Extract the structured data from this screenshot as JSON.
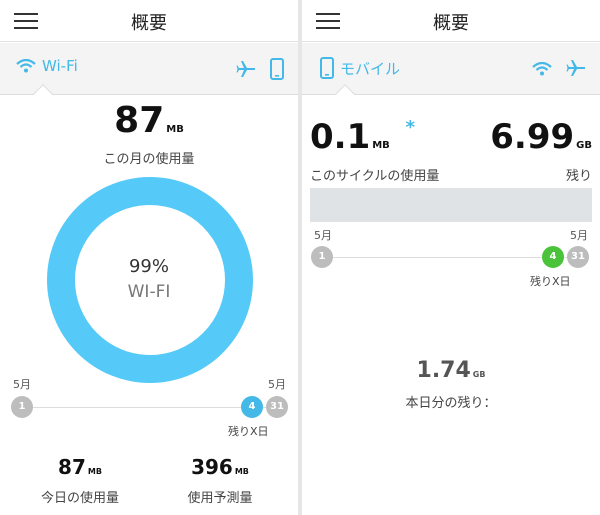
{
  "left": {
    "title": "概要",
    "selector": {
      "label": "Wi-Fi",
      "icon": "wifi-icon"
    },
    "icons": [
      "airplane-icon",
      "phone-icon"
    ],
    "usage": {
      "value": "87",
      "unit": "MB",
      "label": "この月の使用量"
    },
    "donut": {
      "percent": "99%",
      "label": "WI-FI",
      "fill": 0.99,
      "color": "#55caf8"
    },
    "timeline": {
      "start_month": "5月",
      "end_month": "5月",
      "start_day": "1",
      "today": "4",
      "end_day": "31",
      "remaining_label": "残りX日"
    },
    "stats": [
      {
        "value": "87",
        "unit": "MB",
        "label": "今日の使用量"
      },
      {
        "value": "396",
        "unit": "MB",
        "label": "使用予測量"
      }
    ]
  },
  "right": {
    "title": "概要",
    "selector": {
      "label": "モバイル",
      "icon": "phone-icon"
    },
    "icons": [
      "wifi-icon",
      "airplane-icon"
    ],
    "used": {
      "value": "0.1",
      "unit": "MB",
      "mark": "*",
      "label": "このサイクルの使用量"
    },
    "remaining": {
      "value": "6.99",
      "unit": "GB",
      "label": "残り"
    },
    "usage_bar_fill": 0.0,
    "timeline": {
      "start_month": "5月",
      "end_month": "5月",
      "start_day": "1",
      "today": "4",
      "end_day": "31",
      "remaining_label": "残りX日"
    },
    "daily": {
      "value": "1.74",
      "unit": "GB",
      "label": "本日分の残り："
    }
  },
  "colors": {
    "accent": "#44b9e8",
    "ring": "#55caf8",
    "today_mobile": "#4ac33b",
    "day_gray": "#bdbdbd"
  }
}
